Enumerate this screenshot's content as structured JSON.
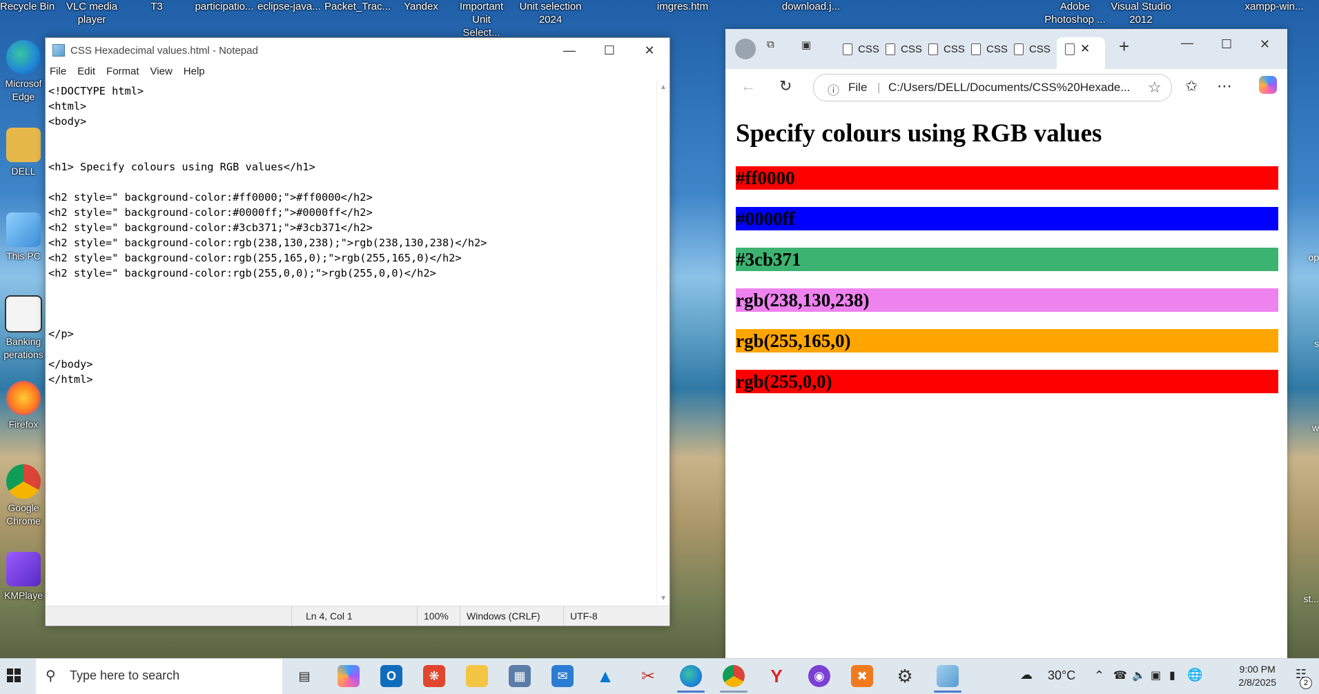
{
  "desktop": {
    "top_labels": [
      {
        "id": "recycle",
        "text": "Recycle Bin"
      },
      {
        "id": "vlc",
        "text": "VLC media player"
      },
      {
        "id": "t3",
        "text": "T3"
      },
      {
        "id": "particip",
        "text": "participatio..."
      },
      {
        "id": "eclipse",
        "text": "eclipse-java..."
      },
      {
        "id": "packet",
        "text": "Packet_Trac..."
      },
      {
        "id": "yandex",
        "text": "Yandex"
      },
      {
        "id": "important",
        "text": "Important Unit Select..."
      },
      {
        "id": "unitsel",
        "text": "Unit selection 2024"
      },
      {
        "id": "imgres",
        "text": "imgres.htm"
      },
      {
        "id": "download",
        "text": "download.j..."
      },
      {
        "id": "photoshop",
        "text": "Adobe Photoshop ..."
      },
      {
        "id": "vs2012",
        "text": "Visual Studio 2012"
      },
      {
        "id": "xampp",
        "text": "xampp-win..."
      }
    ],
    "left_icons": [
      {
        "line1": "Microsof",
        "line2": "Edge",
        "color": "#1f86d6"
      },
      {
        "line1": "DELL",
        "line2": "",
        "color": "#e6b84a"
      },
      {
        "line1": "This PC",
        "line2": "",
        "color": "#5aa7e6"
      },
      {
        "line1": "Banking",
        "line2": "perations",
        "color": "#f0f0f0"
      },
      {
        "line1": "Firefox",
        "line2": "",
        "color": "#ff7a1f"
      },
      {
        "line1": "Google",
        "line2": "Chrome",
        "color": "#db4437"
      },
      {
        "line1": "KMPlaye",
        "line2": "",
        "color": "#6b3fd4"
      }
    ],
    "right_peek": [
      {
        "text": "op"
      },
      {
        "text": "s"
      },
      {
        "text": "w"
      },
      {
        "text": "st..."
      }
    ]
  },
  "notepad": {
    "title": "CSS Hexadecimal values.html - Notepad",
    "menu": [
      "File",
      "Edit",
      "Format",
      "View",
      "Help"
    ],
    "lines": [
      "<!DOCTYPE html>",
      "<html>",
      "<body>",
      "",
      "",
      "<h1> Specify colours using RGB values</h1>",
      "",
      "<h2 style=\" background-color:#ff0000;\">#ff0000</h2>",
      "<h2 style=\" background-color:#0000ff;\">#0000ff</h2>",
      "<h2 style=\" background-color:#3cb371;\">#3cb371</h2>",
      "<h2 style=\" background-color:rgb(238,130,238);\">rgb(238,130,238)</h2>",
      "<h2 style=\" background-color:rgb(255,165,0);\">rgb(255,165,0)</h2>",
      "<h2 style=\" background-color:rgb(255,0,0);\">rgb(255,0,0)</h2>",
      "",
      "",
      "",
      "</p>",
      "",
      "</body>",
      "</html>"
    ],
    "status": {
      "position": "Ln 4, Col 1",
      "zoom": "100%",
      "eol": "Windows (CRLF)",
      "encoding": "UTF-8"
    }
  },
  "browser": {
    "tabs": [
      {
        "label": "CSS"
      },
      {
        "label": "CSS"
      },
      {
        "label": "CSS"
      },
      {
        "label": "CSS"
      },
      {
        "label": "CSS"
      }
    ],
    "address_scheme": "File",
    "address": "C:/Users/DELL/Documents/CSS%20Hexade...",
    "page": {
      "heading": "Specify colours using RGB values",
      "bars": [
        {
          "text": "#ff0000",
          "color": "#ff0000"
        },
        {
          "text": "#0000ff",
          "color": "#0000ff"
        },
        {
          "text": "#3cb371",
          "color": "#3cb371"
        },
        {
          "text": "rgb(238,130,238)",
          "color": "#ee82ee"
        },
        {
          "text": "rgb(255,165,0)",
          "color": "#ffa500"
        },
        {
          "text": "rgb(255,0,0)",
          "color": "#ff0000"
        }
      ]
    }
  },
  "taskbar": {
    "search_placeholder": "Type here to search",
    "weather": "30°C",
    "time": "9:00 PM",
    "date": "2/8/2025",
    "notification_count": "2"
  }
}
